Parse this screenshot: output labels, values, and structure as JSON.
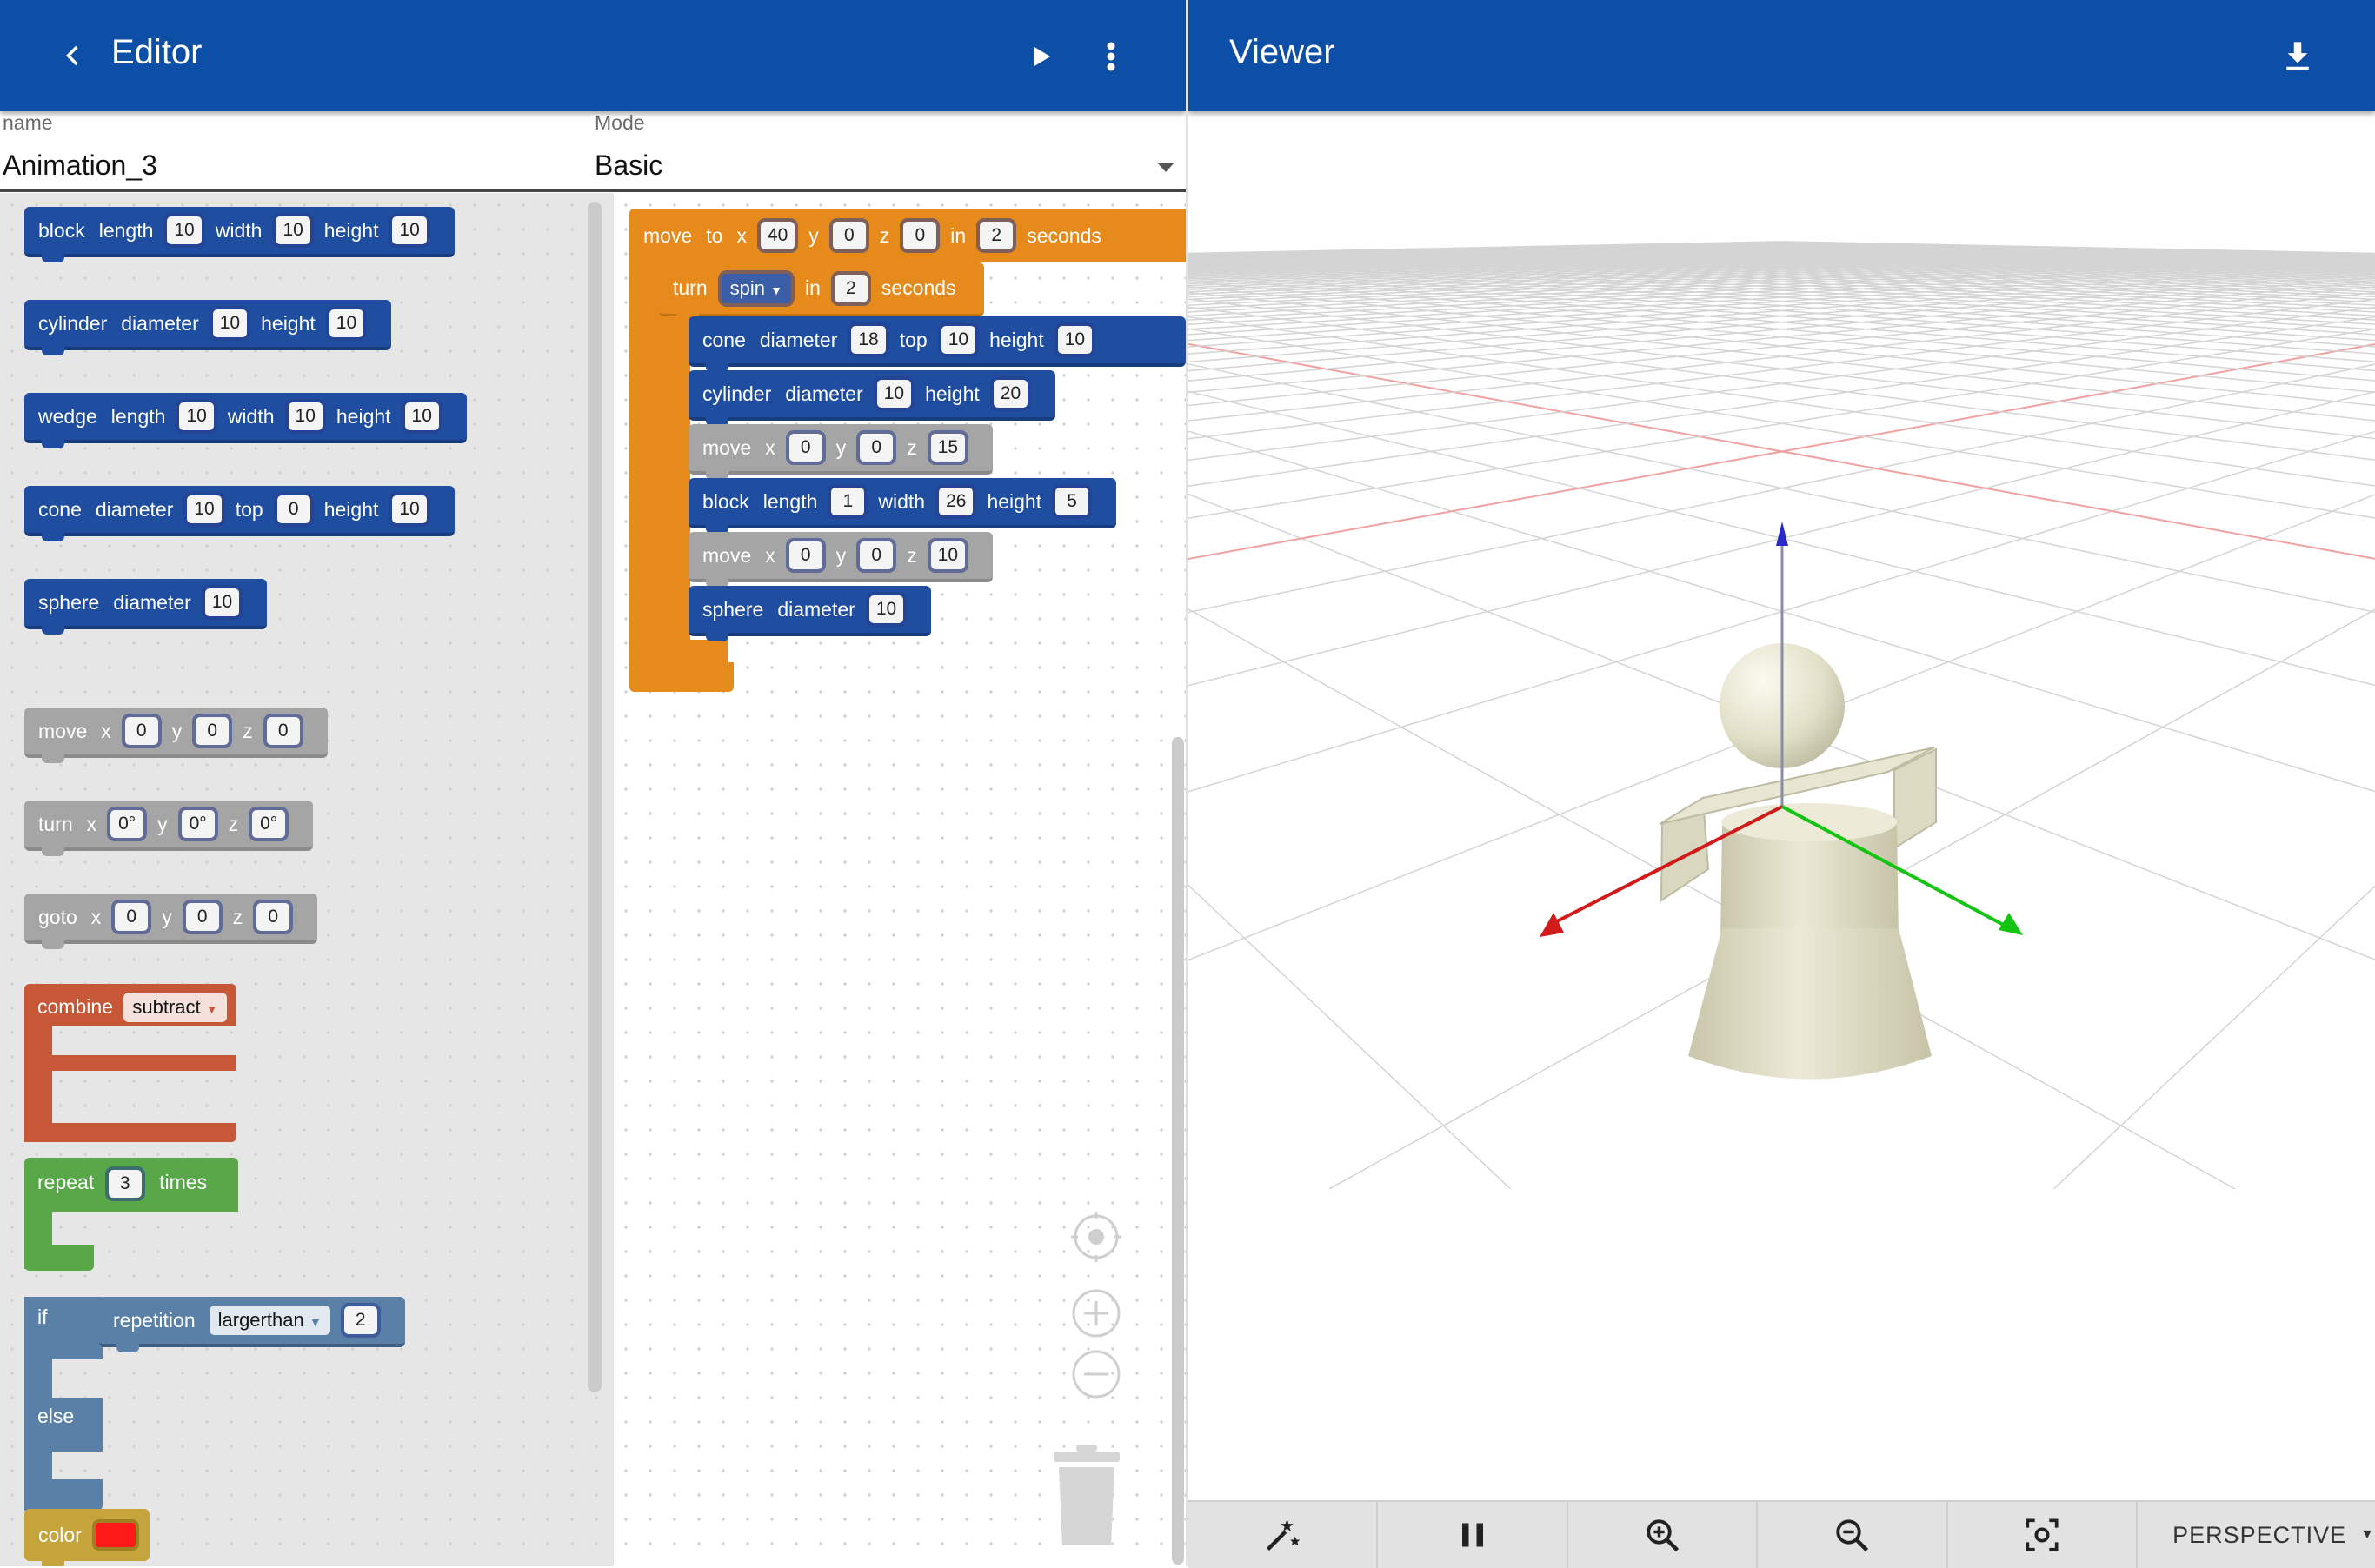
{
  "editor": {
    "title": "Editor",
    "back_icon": "back-arrow-icon",
    "run_icon": "play-icon",
    "menu_icon": "more-vert-icon",
    "name_label": "name",
    "name_value": "Animation_3",
    "mode_label": "Mode",
    "mode_value": "Basic"
  },
  "viewer": {
    "title": "Viewer",
    "download_icon": "download-icon",
    "toolbar": {
      "icons": [
        "magic-wand-icon",
        "pause-icon",
        "zoom-in-icon",
        "zoom-out-icon",
        "fit-view-icon"
      ],
      "projection": "PERSPECTIVE"
    }
  },
  "colors": {
    "appbar": "#0d4ea6",
    "shape_block": "#1f4ea1",
    "transform_block": "#a5a5a5",
    "animation_block": "#e68a1b",
    "combine_block": "#c65837",
    "loop_block": "#58a84a",
    "logic_block": "#5b80a8",
    "color_block": "#c5a53b",
    "axis_x": "#d11a1a",
    "axis_y": "#13c413",
    "axis_z": "#1a1ad1"
  },
  "toolbox": {
    "block": {
      "name": "block",
      "l1": "length",
      "v1": "10",
      "l2": "width",
      "v2": "10",
      "l3": "height",
      "v3": "10"
    },
    "cylinder": {
      "name": "cylinder",
      "l1": "diameter",
      "v1": "10",
      "l2": "height",
      "v2": "10"
    },
    "wedge": {
      "name": "wedge",
      "l1": "length",
      "v1": "10",
      "l2": "width",
      "v2": "10",
      "l3": "height",
      "v3": "10"
    },
    "cone": {
      "name": "cone",
      "l1": "diameter",
      "v1": "10",
      "l2": "top",
      "v2": "0",
      "l3": "height",
      "v3": "10"
    },
    "sphere": {
      "name": "sphere",
      "l1": "diameter",
      "v1": "10"
    },
    "move": {
      "name": "move",
      "x": "x",
      "vx": "0",
      "y": "y",
      "vy": "0",
      "z": "z",
      "vz": "0"
    },
    "turn": {
      "name": "turn",
      "x": "x",
      "vx": "0°",
      "y": "y",
      "vy": "0°",
      "z": "z",
      "vz": "0°"
    },
    "goto": {
      "name": "goto",
      "x": "x",
      "vx": "0",
      "y": "y",
      "vy": "0",
      "z": "z",
      "vz": "0"
    },
    "combine": {
      "name": "combine",
      "op": "subtract"
    },
    "repeat": {
      "name": "repeat",
      "count": "3",
      "suffix": "times"
    },
    "ifelse": {
      "if": "if",
      "var": "repetition",
      "op": "largerthan",
      "value": "2",
      "else": "else"
    },
    "color": {
      "name": "color",
      "swatch": "#ff1a1a"
    }
  },
  "program": {
    "moveto": {
      "name": "move",
      "to": "to",
      "x": "x",
      "vx": "40",
      "y": "y",
      "vy": "0",
      "z": "z",
      "vz": "0",
      "in": "in",
      "dur": "2",
      "unit": "seconds"
    },
    "turn": {
      "name": "turn",
      "mode": "spin",
      "in": "in",
      "dur": "2",
      "unit": "seconds"
    },
    "cone": {
      "name": "cone",
      "l1": "diameter",
      "v1": "18",
      "l2": "top",
      "v2": "10",
      "l3": "height",
      "v3": "10"
    },
    "cylinder": {
      "name": "cylinder",
      "l1": "diameter",
      "v1": "10",
      "l2": "height",
      "v2": "20"
    },
    "move1": {
      "name": "move",
      "x": "x",
      "vx": "0",
      "y": "y",
      "vy": "0",
      "z": "z",
      "vz": "15"
    },
    "block": {
      "name": "block",
      "l1": "length",
      "v1": "1",
      "l2": "width",
      "v2": "26",
      "l3": "height",
      "v3": "5"
    },
    "move2": {
      "name": "move",
      "x": "x",
      "vx": "0",
      "y": "y",
      "vy": "0",
      "z": "z",
      "vz": "10"
    },
    "sphere": {
      "name": "sphere",
      "l1": "diameter",
      "v1": "10"
    }
  },
  "workspace_controls": [
    "recenter-icon",
    "zoom-in-icon",
    "zoom-out-icon",
    "trash-icon"
  ]
}
